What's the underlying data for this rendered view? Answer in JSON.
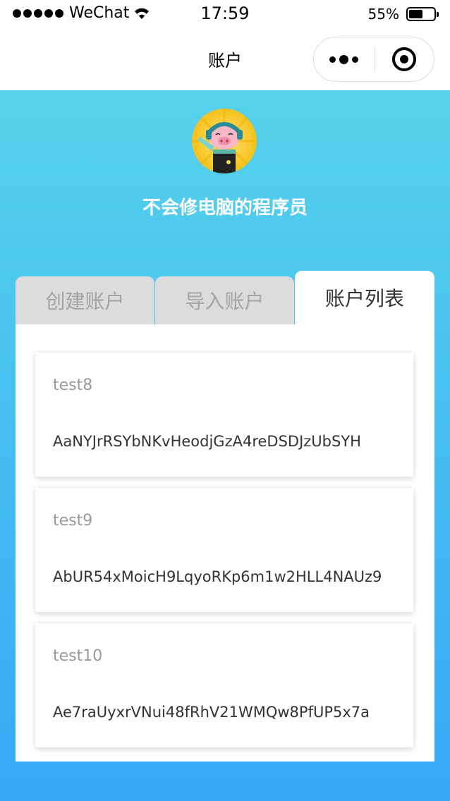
{
  "status_bar": {
    "carrier": "WeChat",
    "time": "17:59",
    "battery": "55%",
    "battery_level": 0.55
  },
  "nav": {
    "title": "账户"
  },
  "profile": {
    "username": "不会修电脑的程序员"
  },
  "tabs": [
    {
      "label": "创建账户",
      "active": false
    },
    {
      "label": "导入账户",
      "active": false
    },
    {
      "label": "账户列表",
      "active": true
    }
  ],
  "accounts": [
    {
      "name": "test8",
      "address": "AaNYJrRSYbNKvHeodjGzA4reDSDJzUbSYH"
    },
    {
      "name": "test9",
      "address": "AbUR54xMoicH9LqyoRKp6m1w2HLL4NAUz9"
    },
    {
      "name": "test10",
      "address": "Ae7raUyxrVNui48fRhV21WMQw8PfUP5x7a"
    }
  ],
  "colors": {
    "gradient_top": "#56d2ec",
    "gradient_bottom": "#36a8f8",
    "tab_inactive_bg": "#dcdcdc"
  }
}
